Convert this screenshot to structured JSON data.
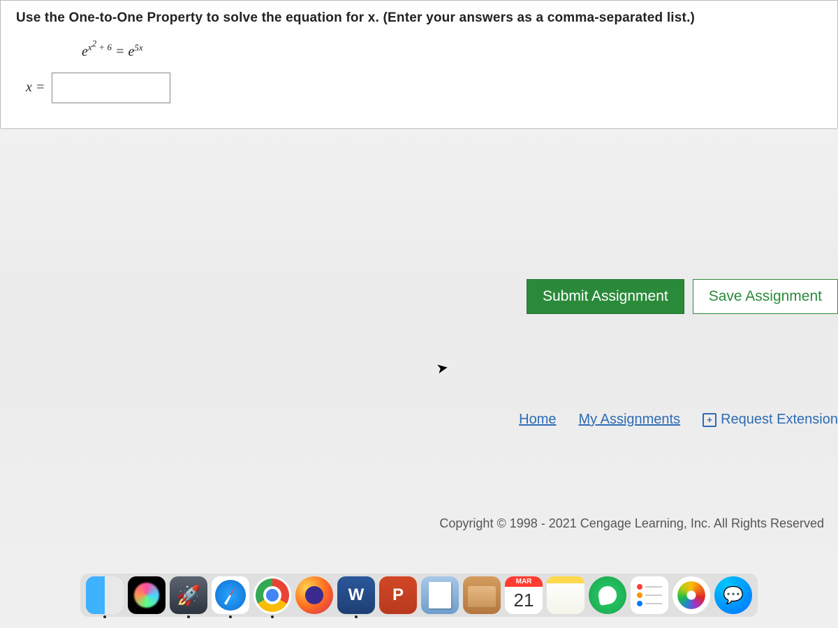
{
  "question": {
    "prompt": "Use the One-to-One Property to solve the equation for x. (Enter your answers as a comma-separated list.)",
    "equation": {
      "base1": "e",
      "exp1a": "x",
      "exp1b": "2",
      "exp1_suffix": " + 6",
      "eq": " = ",
      "base2": "e",
      "exp2": "5x"
    },
    "answer_label": "x =",
    "answer_value": ""
  },
  "buttons": {
    "submit": "Submit Assignment",
    "save": "Save Assignment"
  },
  "nav": {
    "home": "Home",
    "my_assignments": "My Assignments",
    "request_ext": "Request Extension"
  },
  "footer": {
    "copyright": "Copyright © 1998 - 2021 Cengage Learning, Inc. All Rights Reserved"
  },
  "dock": {
    "calendar_month": "MAR",
    "calendar_day": "21",
    "word_letter": "W",
    "ppt_letter": "P"
  }
}
